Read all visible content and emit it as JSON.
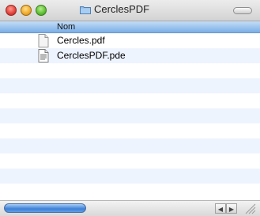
{
  "window": {
    "title": "CerclesPDF",
    "title_icon": "folder-icon"
  },
  "list": {
    "column_header": "Nom",
    "files": [
      {
        "name": "Cercles.pdf",
        "icon": "pdf-document-icon"
      },
      {
        "name": "CerclesPDF.pde",
        "icon": "text-document-icon"
      }
    ]
  },
  "scrollbar": {
    "left_arrow": "◀",
    "right_arrow": "▶"
  },
  "colors": {
    "header_blue": "#79aee7",
    "stripe": "#eef4fe",
    "close": "#e0403a",
    "minimize": "#f0a92b",
    "zoom": "#5bbf31"
  }
}
